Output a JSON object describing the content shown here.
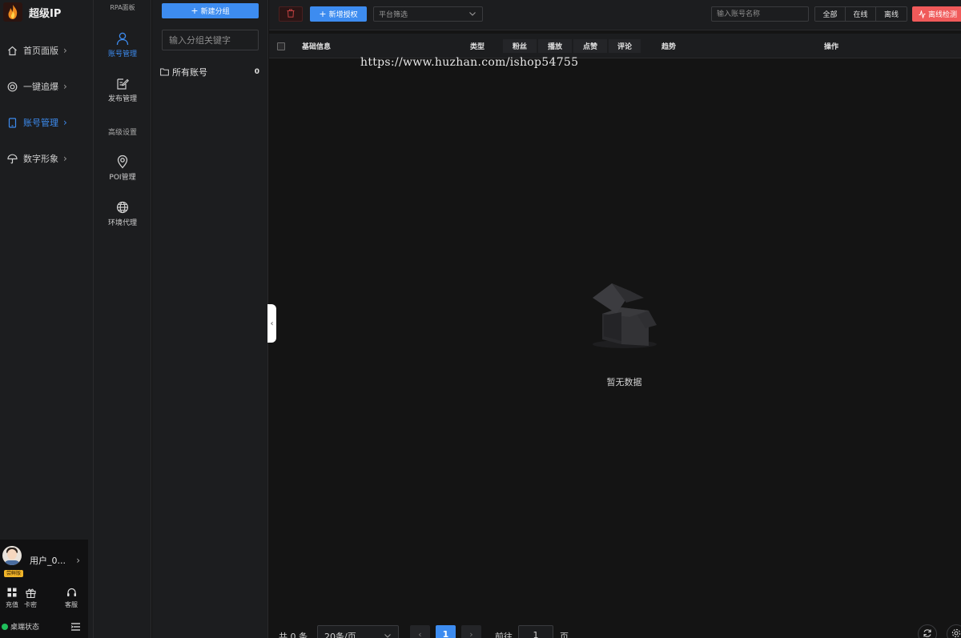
{
  "app": {
    "title": "超级IP"
  },
  "nav": {
    "items": [
      {
        "label": "首页面版",
        "icon": "home-icon"
      },
      {
        "label": "一键追爆",
        "icon": "target-icon"
      },
      {
        "label": "账号管理",
        "icon": "tablet-icon",
        "active": true
      },
      {
        "label": "数字形象",
        "icon": "umbrella-icon"
      }
    ]
  },
  "user": {
    "name": "用户_0...",
    "badge": "尝鲜版",
    "quick": [
      {
        "label": "充值",
        "icon": "grid-icon"
      },
      {
        "label": "卡密",
        "icon": "gift-icon"
      },
      {
        "label": "客服",
        "icon": "headset-icon"
      }
    ],
    "status": "桌端状态"
  },
  "sub_nav": {
    "title": "RPA面板",
    "items": [
      {
        "label": "账号管理",
        "icon": "user-icon",
        "active": true
      },
      {
        "label": "发布管理",
        "icon": "edit-doc-icon"
      }
    ],
    "section": "高级设置",
    "advanced": [
      {
        "label": "POI管理",
        "icon": "location-pin-icon"
      },
      {
        "label": "环境代理",
        "icon": "globe-icon"
      }
    ]
  },
  "groups": {
    "new_button": "新建分组",
    "search_placeholder": "输入分组关键字",
    "items": [
      {
        "label": "所有账号",
        "count": "0"
      }
    ]
  },
  "toolbar": {
    "new_auth": "新增授权",
    "platform_placeholder": "平台筛选",
    "account_search_placeholder": "输入账号名称",
    "segments": [
      "全部",
      "在线",
      "离线"
    ],
    "offline_detect": "离线检测"
  },
  "table": {
    "columns": [
      "基础信息",
      "类型",
      "粉丝",
      "播放",
      "点赞",
      "评论",
      "趋势",
      "操作"
    ]
  },
  "watermark": "https://www.huzhan.com/ishop54755",
  "empty": {
    "text": "暂无数据"
  },
  "pagination": {
    "total": "共 0 条",
    "page_size": "20条/页",
    "current_page": "1",
    "goto_label": "前往",
    "goto_value": "1",
    "page_suffix": "页"
  },
  "colors": {
    "accent": "#3d8cf0",
    "danger": "#f05a5a",
    "online": "#1fbf5b",
    "background": "#141414",
    "panel": "#1c1d1f"
  }
}
